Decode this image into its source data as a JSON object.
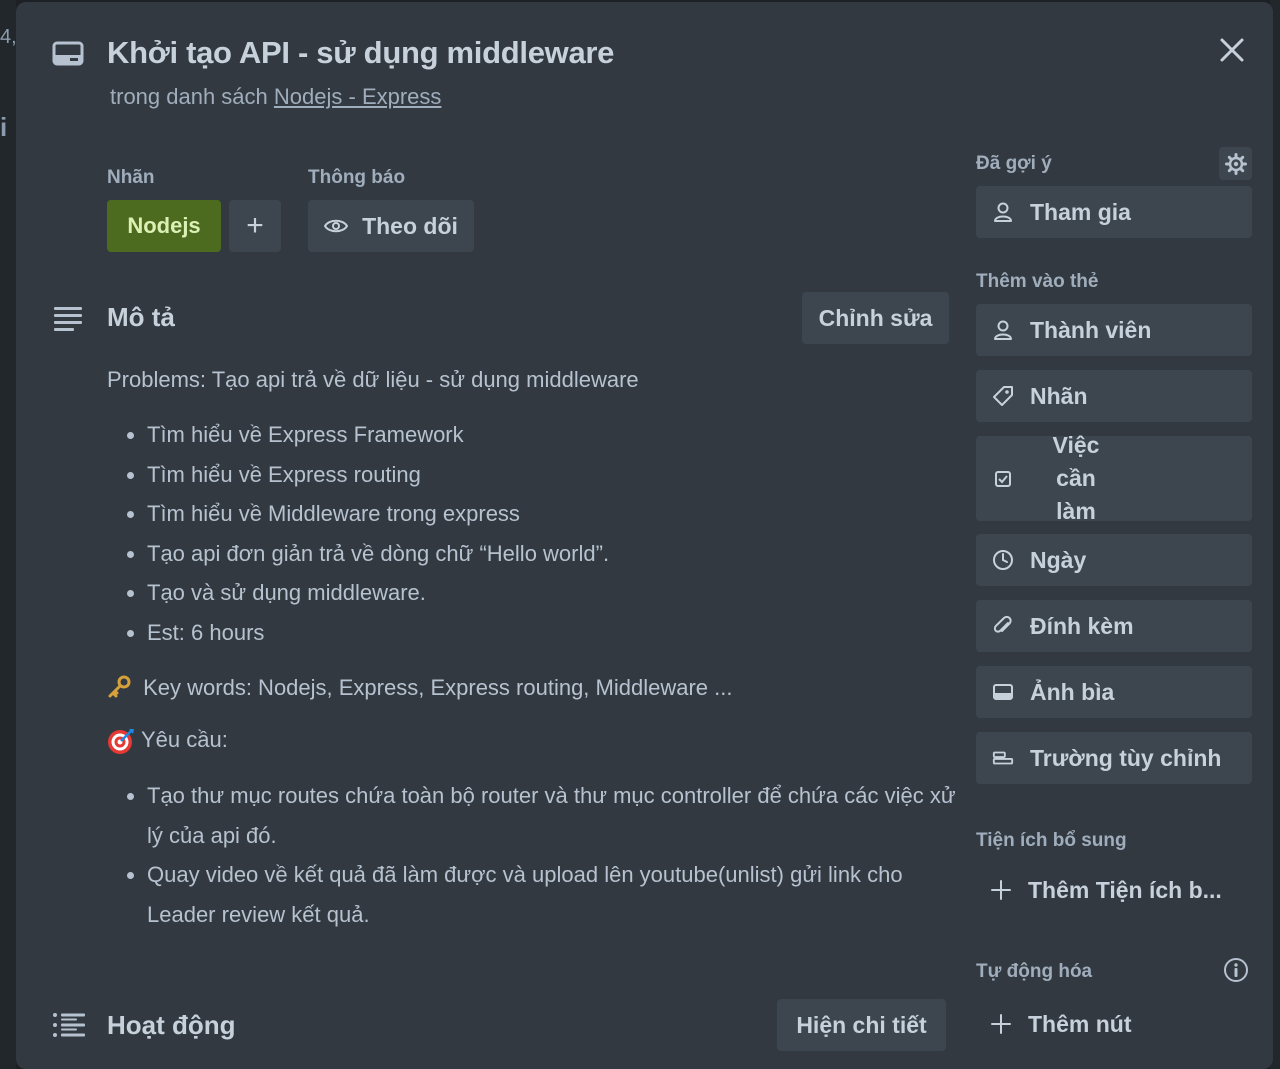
{
  "backdrop": {
    "fragment_top": "4,",
    "fragment_mid": "i"
  },
  "card": {
    "title": "Khởi tạo API - sử dụng middleware",
    "subtitle_prefix": "trong danh sách ",
    "list_name": "Nodejs - Express"
  },
  "labels": {
    "heading": "Nhãn",
    "items": [
      "Nodejs"
    ],
    "add_symbol": "+"
  },
  "notifications": {
    "heading": "Thông báo",
    "watch_label": "Theo dõi"
  },
  "description": {
    "heading": "Mô tả",
    "edit_label": "Chỉnh sửa",
    "problems": "Problems: Tạo api trả về dữ liệu - sử dụng middleware",
    "tasks": [
      "Tìm hiểu về Express Framework",
      "Tìm hiểu về Express routing",
      "Tìm hiểu về Middleware trong express",
      "Tạo api đơn giản trả về dòng chữ “Hello world”.",
      "Tạo và sử dụng middleware.",
      "Est: 6 hours"
    ],
    "keywords": "Key words: Nodejs, Express, Express routing, Middleware ...",
    "requirements_heading": "Yêu cầu:",
    "requirements": [
      "Tạo thư mục routes chứa toàn bộ router và thư mục controller để chứa các việc xử lý của api đó.",
      "Quay video về kết quả đã làm được và upload lên youtube(unlist) gửi link cho Leader review kết quả."
    ]
  },
  "activity": {
    "heading": "Hoạt động",
    "details_label": "Hiện chi tiết"
  },
  "sidebar": {
    "suggested_heading": "Đã gợi ý",
    "join_label": "Tham gia",
    "add_to_card_heading": "Thêm vào thẻ",
    "members_label": "Thành viên",
    "labels_label": "Nhãn",
    "checklist_line1": "Việc cần",
    "checklist_line2": "làm",
    "dates_label": "Ngày",
    "attachment_label": "Đính kèm",
    "cover_label": "Ảnh bìa",
    "custom_fields_label": "Trường tùy chỉnh",
    "powerups_heading": "Tiện ích bổ sung",
    "add_powerup_label": "Thêm Tiện ích b...",
    "automation_heading": "Tự động hóa",
    "add_button_label": "Thêm nút"
  },
  "colors": {
    "modal_bg": "#323940",
    "button_bg": "#3d464f",
    "label_green": "#4c6b1f"
  }
}
